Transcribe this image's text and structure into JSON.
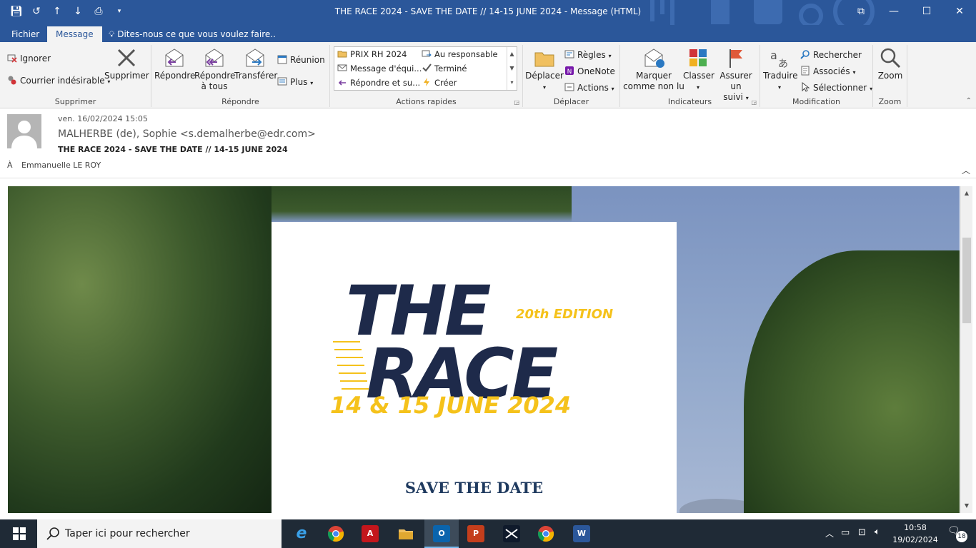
{
  "window": {
    "title": "THE RACE 2024 - SAVE THE DATE // 14-15 JUNE 2024 - Message (HTML)",
    "qat_icons": [
      "save-icon",
      "undo-icon",
      "up-arrow-icon",
      "down-arrow-icon",
      "print-preview-icon",
      "customize-qat-icon"
    ],
    "controls": {
      "restore_ribbon": "⧉",
      "minimize": "—",
      "maximize": "☐",
      "close": "✕"
    }
  },
  "tabs": {
    "file": "Fichier",
    "message": "Message",
    "tell_me": "Dites-nous ce que vous voulez faire.."
  },
  "ribbon": {
    "delete_group": {
      "label": "Supprimer",
      "ignore": "Ignorer",
      "junk": "Courrier indésirable",
      "delete": "Supprimer"
    },
    "respond_group": {
      "label": "Répondre",
      "reply": "Répondre",
      "reply_all_1": "Répondre",
      "reply_all_2": "à tous",
      "forward": "Transférer",
      "meeting": "Réunion",
      "more": "Plus"
    },
    "quick_steps": {
      "label": "Actions rapides",
      "items": [
        "PRIX RH 2024",
        "Au responsable",
        "Message d'équi...",
        "Terminé",
        "Répondre et su...",
        "Créer"
      ]
    },
    "move_group": {
      "label": "Déplacer",
      "move": "Déplacer",
      "rules": "Règles",
      "onenote": "OneNote",
      "actions": "Actions"
    },
    "tags_group": {
      "label": "Indicateurs",
      "mark_unread_1": "Marquer",
      "mark_unread_2": "comme non lu",
      "categorize": "Classer",
      "follow_up_1": "Assurer un",
      "follow_up_2": "suivi"
    },
    "edit_group": {
      "label": "Modification",
      "translate": "Traduire",
      "find": "Rechercher",
      "related": "Associés",
      "select": "Sélectionner"
    },
    "zoom_group": {
      "label": "Zoom",
      "zoom": "Zoom"
    }
  },
  "message": {
    "date": "ven. 16/02/2024 15:05",
    "from": "MALHERBE (de), Sophie <s.demalherbe@edr.com>",
    "subject": "THE RACE 2024 - SAVE THE DATE // 14-15 JUNE 2024",
    "to_label": "À",
    "to": "Emmanuelle LE ROY"
  },
  "body": {
    "logo": {
      "line1": "THE",
      "edition": "20th EDITION",
      "line2": "RACE",
      "dates": "14 & 15 JUNE 2024",
      "navy": "#1e2a4a",
      "yellow": "#f5c21b"
    },
    "save_the_date": "SAVE THE DATE"
  },
  "taskbar": {
    "search_placeholder": "Taper ici pour rechercher",
    "apps": [
      "internet-explorer",
      "chrome",
      "acrobat",
      "file-explorer",
      "outlook",
      "powerpoint",
      "dynamics",
      "chrome",
      "word"
    ],
    "time": "10:58",
    "date": "19/02/2024",
    "notification_count": "18"
  },
  "colors": {
    "accent": "#2b579a",
    "ribbon_bg": "#f3f3f3",
    "taskbar": "#1f2a36"
  }
}
